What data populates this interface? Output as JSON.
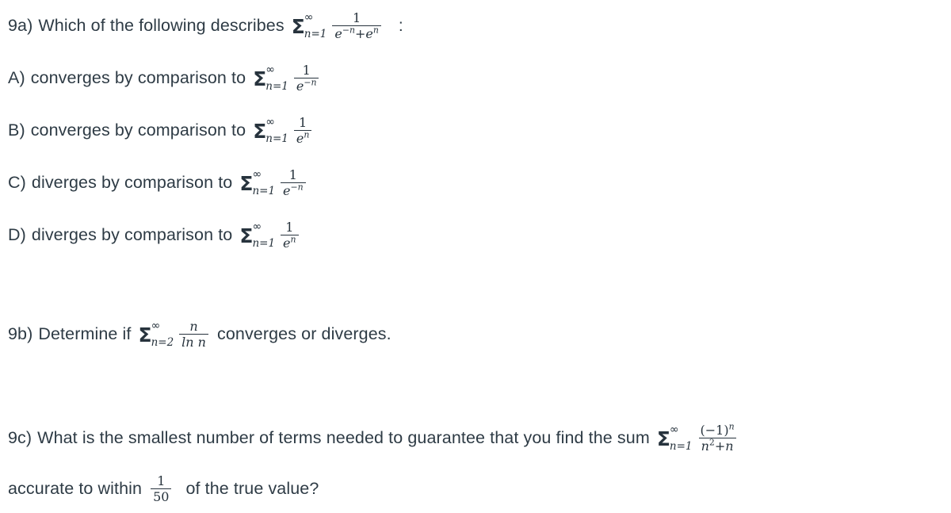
{
  "document": {
    "background_color": "#ffffff",
    "text_color": "#2e3b45"
  },
  "questions": [
    {
      "id": "9a",
      "label": "9a)",
      "prompt": "Which of the following describes",
      "trailing": ":",
      "expression": {
        "sigma": "Σ",
        "upper": "∞",
        "lower": "n=1",
        "numerator": "1",
        "denominator_base_1": "e",
        "denominator_exp_1": "−n",
        "denominator_op": "+",
        "denominator_base_2": "e",
        "denominator_exp_2": "n"
      },
      "options": [
        {
          "id": "A",
          "label": "A)",
          "text": "converges by comparison to",
          "expression": {
            "sigma": "Σ",
            "upper": "∞",
            "lower": "n=1",
            "numerator": "1",
            "denominator_base": "e",
            "denominator_exp": "−n"
          }
        },
        {
          "id": "B",
          "label": "B)",
          "text": "converges by comparison to",
          "expression": {
            "sigma": "Σ",
            "upper": "∞",
            "lower": "n=1",
            "numerator": "1",
            "denominator_base": "e",
            "denominator_exp": "n"
          }
        },
        {
          "id": "C",
          "label": "C)",
          "text": "diverges by comparison to",
          "expression": {
            "sigma": "Σ",
            "upper": "∞",
            "lower": "n=1",
            "numerator": "1",
            "denominator_base": "e",
            "denominator_exp": "−n"
          }
        },
        {
          "id": "D",
          "label": "D)",
          "text": "diverges by comparison to",
          "expression": {
            "sigma": "Σ",
            "upper": "∞",
            "lower": "n=1",
            "numerator": "1",
            "denominator_base": "e",
            "denominator_exp": "n"
          }
        }
      ]
    },
    {
      "id": "9b",
      "label": "9b)",
      "prompt_before": "Determine if",
      "prompt_after": "converges or diverges.",
      "expression": {
        "sigma": "Σ",
        "upper": "∞",
        "lower": "n=2",
        "numerator": "n",
        "denominator": "ln n"
      }
    },
    {
      "id": "9c",
      "label": "9c)",
      "prompt_before": "What is the smallest number of terms needed to guarantee that you find the sum",
      "expression": {
        "sigma": "Σ",
        "upper": "∞",
        "lower": "n=1",
        "numerator": "(−1)",
        "numerator_exp": "n",
        "denominator_base": "n",
        "denominator_exp": "2",
        "denominator_tail": "+n"
      },
      "line2_before": "accurate to within",
      "tolerance": {
        "numerator": "1",
        "denominator": "50"
      },
      "line2_after": "of the true value?"
    }
  ]
}
